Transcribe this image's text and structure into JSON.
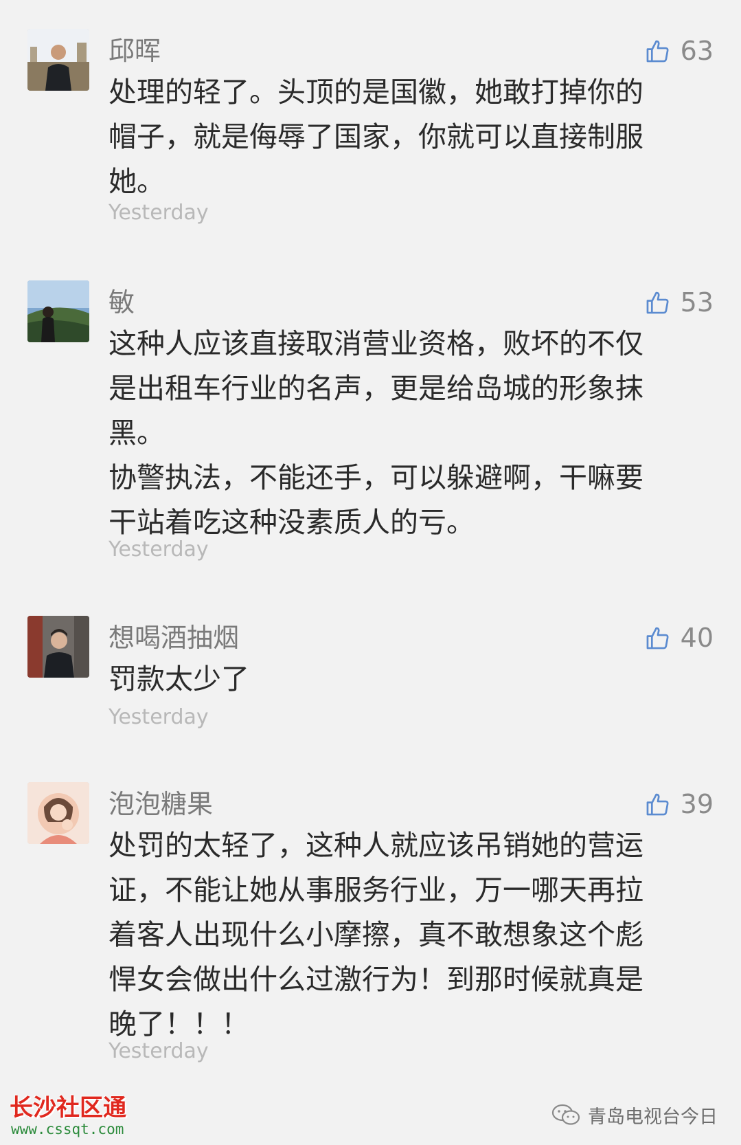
{
  "comments": [
    {
      "name": "邱晖",
      "likes": "63",
      "text": "处理的轻了。头顶的是国徽，她敢打掉你的\n帽子，就是侮辱了国家，你就可以直接制服\n她。",
      "time": "Yesterday"
    },
    {
      "name": "敏",
      "likes": "53",
      "text": "这种人应该直接取消营业资格，败坏的不仅\n是出租车行业的名声，更是给岛城的形象抹\n黑。\n协警执法，不能还手，可以躲避啊，干嘛要\n干站着吃这种没素质人的亏。",
      "time": "Yesterday"
    },
    {
      "name": "想喝酒抽烟",
      "likes": "40",
      "text": "罚款太少了",
      "time": "Yesterday"
    },
    {
      "name": "泡泡糖果",
      "likes": "39",
      "text": "处罚的太轻了，这种人就应该吊销她的营运\n证，不能让她从事服务行业，万一哪天再拉\n着客人出现什么小摩擦，真不敢想象这个彪\n悍女会做出什么过激行为！到那时候就真是\n晚了！！！",
      "time": "Yesterday"
    }
  ],
  "watermark_left": {
    "title": "长沙社区通",
    "url": "www.cssqt.com"
  },
  "watermark_right": {
    "text": "青岛电视台今日"
  },
  "colors": {
    "background": "#f2f2f2",
    "nickname": "#7a7a7a",
    "content": "#2a2a2a",
    "time": "#b8b8b8",
    "like_icon": "#5b8bd0",
    "watermark_red": "#e0281e",
    "watermark_green": "#2a8a3a"
  },
  "icons": {
    "like": "thumbs-up-icon",
    "wechat": "wechat-icon"
  }
}
